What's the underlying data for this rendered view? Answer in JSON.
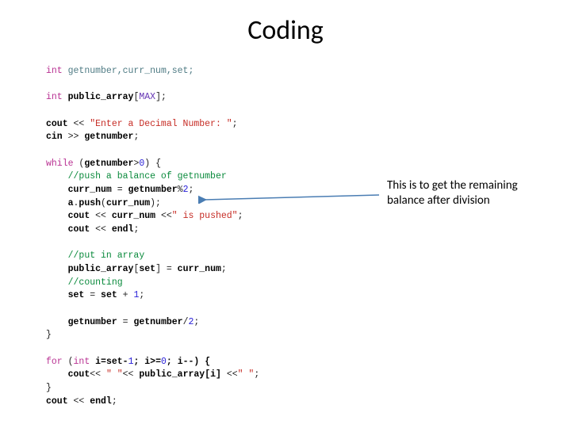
{
  "title": "Coding",
  "annotation": {
    "line1": "This is to get the remaining",
    "line2": "balance after division"
  },
  "code": {
    "l1_kw": "int",
    "l1_vars": " getnumber,curr_num,set;",
    "l2_kw": "int",
    "l2_id": " public_array",
    "l2_br1": "[",
    "l2_type": "MAX",
    "l2_br2": "];",
    "l3_id": "cout",
    "l3_op": " << ",
    "l3_str": "\"Enter a Decimal Number: \"",
    "l3_end": ";",
    "l4_id": "cin",
    "l4_op": " >> ",
    "l4_var": "getnumber",
    "l4_end": ";",
    "l5_kw": "while",
    "l5_open": " (",
    "l5_var": "getnumber",
    "l5_cmp": ">",
    "l5_num": "0",
    "l5_close": ") {",
    "l6_cmt": "//push a balance of getnumber",
    "l7_lhs": "curr_num",
    "l7_eq": " = ",
    "l7_rhs": "getnumber",
    "l7_mod": "%",
    "l7_num": "2",
    "l7_end": ";",
    "l8_obj": "a",
    "l8_dot": ".",
    "l8_fn": "push",
    "l8_open": "(",
    "l8_arg": "curr_num",
    "l8_close": ");",
    "l9_id": "cout",
    "l9_op1": " << ",
    "l9_var": "curr_num",
    "l9_op2": " <<",
    "l9_str": "\" is pushed\"",
    "l9_end": ";",
    "l10_id": "cout",
    "l10_op": " << ",
    "l10_endl": "endl",
    "l10_end": ";",
    "l11_cmt": "//put in array",
    "l12_lhs": "public_array",
    "l12_br1": "[",
    "l12_idx": "set",
    "l12_br2": "] = ",
    "l12_rhs": "curr_num",
    "l12_end": ";",
    "l13_cmt": "//counting",
    "l14_lhs": "set",
    "l14_eq": " = ",
    "l14_rhs": "set",
    "l14_plus": " + ",
    "l14_num": "1",
    "l14_end": ";",
    "l15_lhs": "getnumber",
    "l15_eq": " = ",
    "l15_rhs": "getnumber",
    "l15_div": "/",
    "l15_num": "2",
    "l15_end": ";",
    "l16_close": "}",
    "l17_kw": "for",
    "l17_open": " (",
    "l17_int": "int",
    "l17_init": " i=set-",
    "l17_num1": "1",
    "l17_sep1": "; i>=",
    "l17_num2": "0",
    "l17_sep2": "; i--) {",
    "l18_id": "cout",
    "l18_op1": "<< ",
    "l18_str1": "\" \"",
    "l18_op2": "<< ",
    "l18_arr": "public_array",
    "l18_br1": "[i] ",
    "l18_op3": "<<",
    "l18_str2": "\" \"",
    "l18_end": ";",
    "l19_close": "}",
    "l20_id": "cout",
    "l20_op": " << ",
    "l20_endl": "endl",
    "l20_end": ";"
  },
  "colors": {
    "keyword": "#b93293",
    "string": "#c62c25",
    "number": "#2920d8",
    "comment": "#0a8a3c",
    "arrow": "#4a7db3"
  }
}
